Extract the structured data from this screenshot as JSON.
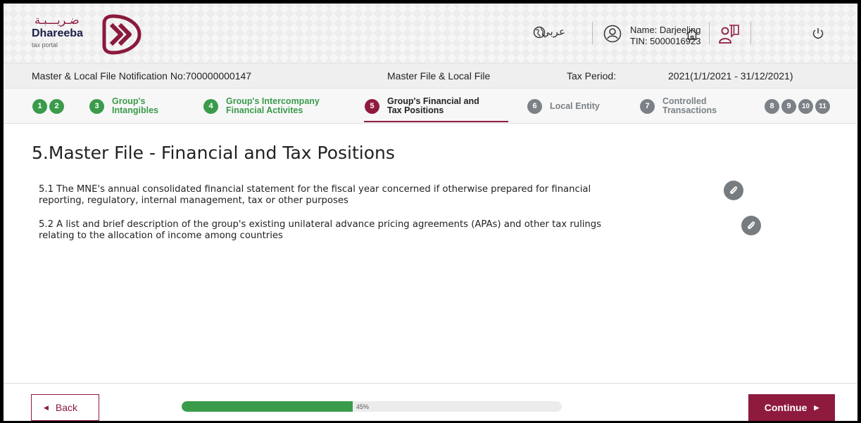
{
  "header": {
    "logo_arabic": "ضـريـــبـة",
    "logo_brand": "Dhareeba",
    "logo_sub": "tax portal",
    "language_label": "عربي",
    "user_name": "Name: Darjeeling",
    "user_tin": "TIN: 5000016923"
  },
  "infobar": {
    "notification": "Master & Local File Notification No:700000000147",
    "file_type": "Master File & Local File",
    "tax_period_label": "Tax Period:",
    "tax_period_value": "2021(1/1/2021 - 31/12/2021)"
  },
  "steps": {
    "s1": "1",
    "s2": "2",
    "s3": "3",
    "s3_label_1": "Group's",
    "s3_label_2": "Intangibles",
    "s4": "4",
    "s4_label_1": "Group's Intercompany",
    "s4_label_2": "Financial Activites",
    "s5": "5",
    "s5_label_1": "Group's Financial and",
    "s5_label_2": "Tax Positions",
    "s6": "6",
    "s6_label": "Local Entity",
    "s7": "7",
    "s7_label_1": "Controlled",
    "s7_label_2": "Transactions",
    "s8": "8",
    "s9": "9",
    "s10": "10",
    "s11": "11",
    "active": 5
  },
  "main": {
    "title": "5.Master File - Financial and Tax Positions",
    "items": [
      {
        "line1": "5.1 The MNE's annual consolidated financial statement for the fiscal year concerned if otherwise prepared for financial",
        "line2": "reporting, regulatory, internal management, tax or other purposes"
      },
      {
        "line1": "5.2 A list and brief description of the group's existing unilateral advance pricing agreements (APAs) and other tax rulings",
        "line2": "relating to the allocation of income among countries"
      }
    ]
  },
  "footer": {
    "back_label": "Back",
    "continue_label": "Continue",
    "progress_percent": 45,
    "progress_text": "45%"
  },
  "colors": {
    "brand": "#8e1b3e",
    "success": "#3a9b4b",
    "neutral": "#7b8186"
  }
}
